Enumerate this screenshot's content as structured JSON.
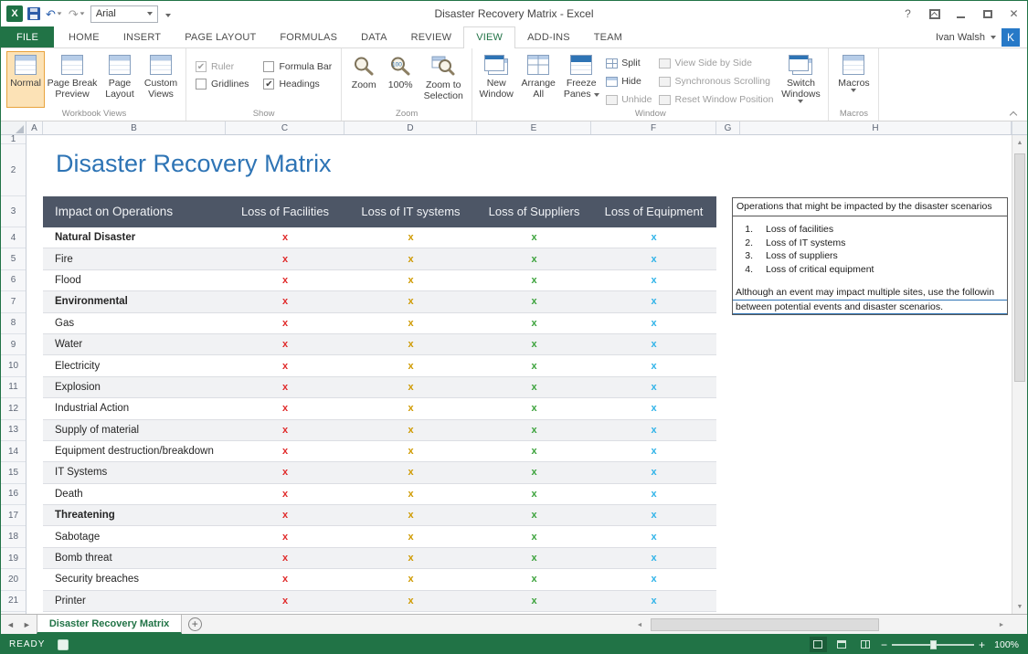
{
  "icons": {
    "excel": "X",
    "help": "?",
    "close": "✕",
    "undo": "↶",
    "redo": "↷",
    "check": "✔",
    "up_arrow": "▲",
    "down_arrow": "▼",
    "left_arrow": "◄",
    "right_arrow": "►",
    "plus": "+",
    "minus": "−",
    "new_sheet": "+",
    "hundred": "100"
  },
  "titlebar": {
    "title": "Disaster Recovery Matrix - Excel",
    "font_box": "Arial"
  },
  "account": {
    "name": "Ivan Walsh",
    "avatar": "K"
  },
  "ribbon_tabs": [
    {
      "label": "FILE",
      "file": true
    },
    {
      "label": "HOME"
    },
    {
      "label": "INSERT"
    },
    {
      "label": "PAGE LAYOUT"
    },
    {
      "label": "FORMULAS"
    },
    {
      "label": "DATA"
    },
    {
      "label": "REVIEW"
    },
    {
      "label": "VIEW",
      "active": true
    },
    {
      "label": "ADD-INS"
    },
    {
      "label": "TEAM"
    }
  ],
  "ribbon": {
    "workbook_views": {
      "label": "Workbook Views",
      "buttons": [
        "Normal",
        "Page Break Preview",
        "Page Layout",
        "Custom Views"
      ]
    },
    "show": {
      "label": "Show",
      "checkboxes": [
        {
          "label": "Ruler",
          "checked": true,
          "disabled": true
        },
        {
          "label": "Formula Bar",
          "checked": false,
          "disabled": false
        },
        {
          "label": "Gridlines",
          "checked": false,
          "disabled": false
        },
        {
          "label": "Headings",
          "checked": true,
          "disabled": false
        }
      ]
    },
    "zoom": {
      "label": "Zoom",
      "buttons": [
        "Zoom",
        "100%",
        "Zoom to Selection"
      ]
    },
    "window": {
      "label": "Window",
      "buttons": [
        "New Window",
        "Arrange All",
        "Freeze Panes",
        "Split",
        "Hide",
        "Unhide",
        "View Side by Side",
        "Synchronous Scrolling",
        "Reset Window Position",
        "Switch Windows"
      ]
    },
    "macros": {
      "label": "Macros",
      "button": "Macros"
    }
  },
  "grid": {
    "columns": [
      "A",
      "B",
      "C",
      "D",
      "E",
      "F",
      "G",
      "H"
    ],
    "rows": [
      "1",
      "2",
      "3",
      "4",
      "5",
      "6",
      "7",
      "8",
      "9",
      "10",
      "11",
      "12",
      "13",
      "14",
      "15",
      "16",
      "17",
      "18",
      "19",
      "20",
      "21"
    ]
  },
  "sheet": {
    "title": "Disaster Recovery Matrix",
    "table": {
      "headers": [
        "Impact on Operations",
        "Loss of Facilities",
        "Loss of IT systems",
        "Loss of Suppliers",
        "Loss of Equipment"
      ],
      "mark": "x",
      "mark_colors": [
        "#e02b2b",
        "#cf9a00",
        "#3ba23b",
        "#2fb3e8"
      ],
      "rows": [
        {
          "name": "Natural Disaster",
          "bold": true
        },
        {
          "name": "Fire",
          "bold": false
        },
        {
          "name": "Flood",
          "bold": false
        },
        {
          "name": "Environmental",
          "bold": true
        },
        {
          "name": "Gas",
          "bold": false
        },
        {
          "name": "Water",
          "bold": false
        },
        {
          "name": "Electricity",
          "bold": false
        },
        {
          "name": "Explosion",
          "bold": false
        },
        {
          "name": "Industrial Action",
          "bold": false
        },
        {
          "name": "Supply of material",
          "bold": false
        },
        {
          "name": "Equipment destruction/breakdown",
          "bold": false
        },
        {
          "name": "IT Systems",
          "bold": false
        },
        {
          "name": "Death",
          "bold": false
        },
        {
          "name": "Threatening",
          "bold": true
        },
        {
          "name": "Sabotage",
          "bold": false
        },
        {
          "name": "Bomb threat",
          "bold": false
        },
        {
          "name": "Security breaches",
          "bold": false
        },
        {
          "name": "Printer",
          "bold": false
        }
      ]
    },
    "note": {
      "heading": "Operations that might be impacted by the disaster scenarios",
      "items": [
        "Loss of facilities",
        "Loss of IT systems",
        "Loss of suppliers",
        "Loss of critical equipment"
      ],
      "paragraph_lines": [
        "Although an event may impact multiple sites, use the followin",
        "between potential events and disaster scenarios."
      ]
    }
  },
  "tabbar": {
    "sheet_name": "Disaster Recovery Matrix"
  },
  "statusbar": {
    "mode": "READY",
    "zoom_level": "100%"
  },
  "colors": {
    "accent_green": "#217346",
    "title_blue": "#2e74b5",
    "table_header_bg": "#4d5666"
  }
}
